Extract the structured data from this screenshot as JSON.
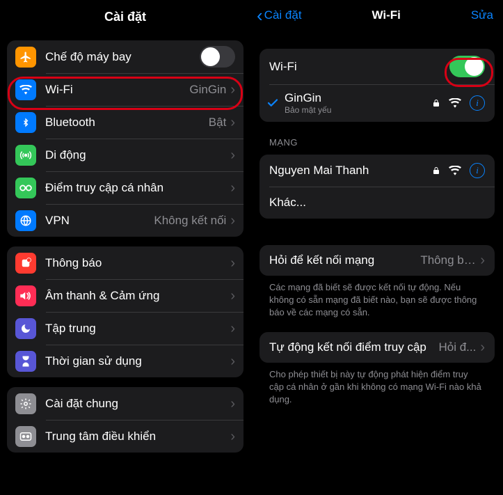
{
  "left": {
    "title": "Cài đặt",
    "groups": [
      {
        "rows": [
          {
            "icon": "airplane",
            "bg": "#ff9500",
            "label": "Chế độ máy bay",
            "toggle": false
          },
          {
            "icon": "wifi",
            "bg": "#007aff",
            "label": "Wi-Fi",
            "value": "GinGin",
            "chevron": true,
            "highlight": true
          },
          {
            "icon": "bluetooth",
            "bg": "#007aff",
            "label": "Bluetooth",
            "value": "Bật",
            "chevron": true
          },
          {
            "icon": "cellular",
            "bg": "#34c759",
            "label": "Di động",
            "chevron": true
          },
          {
            "icon": "hotspot",
            "bg": "#34c759",
            "label": "Điểm truy cập cá nhân",
            "chevron": true
          },
          {
            "icon": "vpn",
            "bg": "#007aff",
            "label": "VPN",
            "value": "Không kết nối",
            "chevron": true
          }
        ]
      },
      {
        "rows": [
          {
            "icon": "notifications",
            "bg": "#ff3b30",
            "label": "Thông báo",
            "chevron": true
          },
          {
            "icon": "sounds",
            "bg": "#ff2d55",
            "label": "Âm thanh & Cảm ứng",
            "chevron": true
          },
          {
            "icon": "focus",
            "bg": "#5856d6",
            "label": "Tập trung",
            "chevron": true
          },
          {
            "icon": "screentime",
            "bg": "#5856d6",
            "label": "Thời gian sử dụng",
            "chevron": true
          }
        ]
      },
      {
        "rows": [
          {
            "icon": "general",
            "bg": "#8e8e93",
            "label": "Cài đặt chung",
            "chevron": true
          },
          {
            "icon": "control",
            "bg": "#8e8e93",
            "label": "Trung tâm điều khiển",
            "chevron": true
          }
        ]
      }
    ]
  },
  "right": {
    "back": "Cài đặt",
    "title": "Wi-Fi",
    "edit": "Sửa",
    "wifi_label": "Wi-Fi",
    "wifi_on": true,
    "connected": {
      "name": "GinGin",
      "security": "Bảo mật yếu"
    },
    "networks_header": "MẠNG",
    "networks": [
      {
        "name": "Nguyen Mai Thanh",
        "lock": true
      }
    ],
    "other": "Khác...",
    "ask": {
      "label": "Hỏi để kết nối mạng",
      "value": "Thông báo"
    },
    "ask_footer": "Các mạng đã biết sẽ được kết nối tự động. Nếu không có sẵn mạng đã biết nào, bạn sẽ được thông báo về các mạng có sẵn.",
    "auto": {
      "label": "Tự động kết nối điểm truy cập",
      "value": "Hỏi đ..."
    },
    "auto_footer": "Cho phép thiết bị này tự động phát hiện điểm truy cập cá nhân ở gần khi không có mạng Wi-Fi nào khả dụng."
  }
}
